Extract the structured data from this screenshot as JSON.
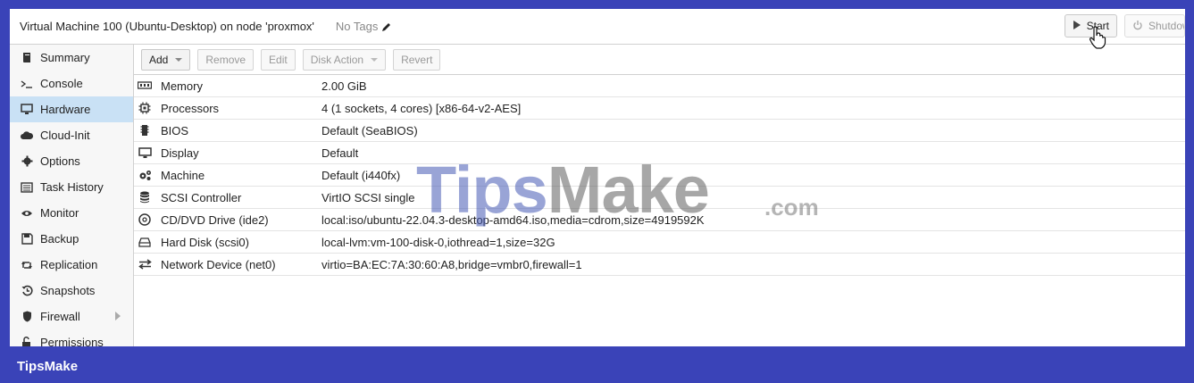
{
  "titlebar": {
    "title": "Virtual Machine 100 (Ubuntu-Desktop) on node 'proxmox'",
    "tags": "No Tags",
    "start_label": "Start",
    "shutdown_label": "Shutdown"
  },
  "sidebar": {
    "items": [
      {
        "label": "Summary",
        "icon": "book-icon"
      },
      {
        "label": "Console",
        "icon": "terminal-icon"
      },
      {
        "label": "Hardware",
        "icon": "desktop-icon"
      },
      {
        "label": "Cloud-Init",
        "icon": "cloud-icon"
      },
      {
        "label": "Options",
        "icon": "gear-icon"
      },
      {
        "label": "Task History",
        "icon": "list-icon"
      },
      {
        "label": "Monitor",
        "icon": "eye-icon"
      },
      {
        "label": "Backup",
        "icon": "floppy-icon"
      },
      {
        "label": "Replication",
        "icon": "retweet-icon"
      },
      {
        "label": "Snapshots",
        "icon": "history-icon"
      },
      {
        "label": "Firewall",
        "icon": "shield-icon"
      },
      {
        "label": "Permissions",
        "icon": "unlock-icon"
      }
    ],
    "active": "Hardware"
  },
  "toolbar": {
    "add": "Add",
    "remove": "Remove",
    "edit": "Edit",
    "disk_action": "Disk Action",
    "revert": "Revert"
  },
  "hardware": [
    {
      "key": "Memory",
      "value": "2.00 GiB",
      "icon": "memory-icon"
    },
    {
      "key": "Processors",
      "value": "4 (1 sockets, 4 cores) [x86-64-v2-AES]",
      "icon": "cpu-icon"
    },
    {
      "key": "BIOS",
      "value": "Default (SeaBIOS)",
      "icon": "microchip-icon"
    },
    {
      "key": "Display",
      "value": "Default",
      "icon": "desktop-icon"
    },
    {
      "key": "Machine",
      "value": "Default (i440fx)",
      "icon": "cogs-icon"
    },
    {
      "key": "SCSI Controller",
      "value": "VirtIO SCSI single",
      "icon": "database-icon"
    },
    {
      "key": "CD/DVD Drive (ide2)",
      "value": "local:iso/ubuntu-22.04.3-desktop-amd64.iso,media=cdrom,size=4919592K",
      "icon": "cdrom-icon"
    },
    {
      "key": "Hard Disk (scsi0)",
      "value": "local-lvm:vm-100-disk-0,iothread=1,size=32G",
      "icon": "hdd-icon"
    },
    {
      "key": "Network Device (net0)",
      "value": "virtio=BA:EC:7A:30:60:A8,bridge=vmbr0,firewall=1",
      "icon": "exchange-icon"
    }
  ],
  "watermark": {
    "part1": "Tips",
    "part2": "Make",
    "suffix": ".com"
  },
  "footer": {
    "brand": "TipsMake"
  }
}
